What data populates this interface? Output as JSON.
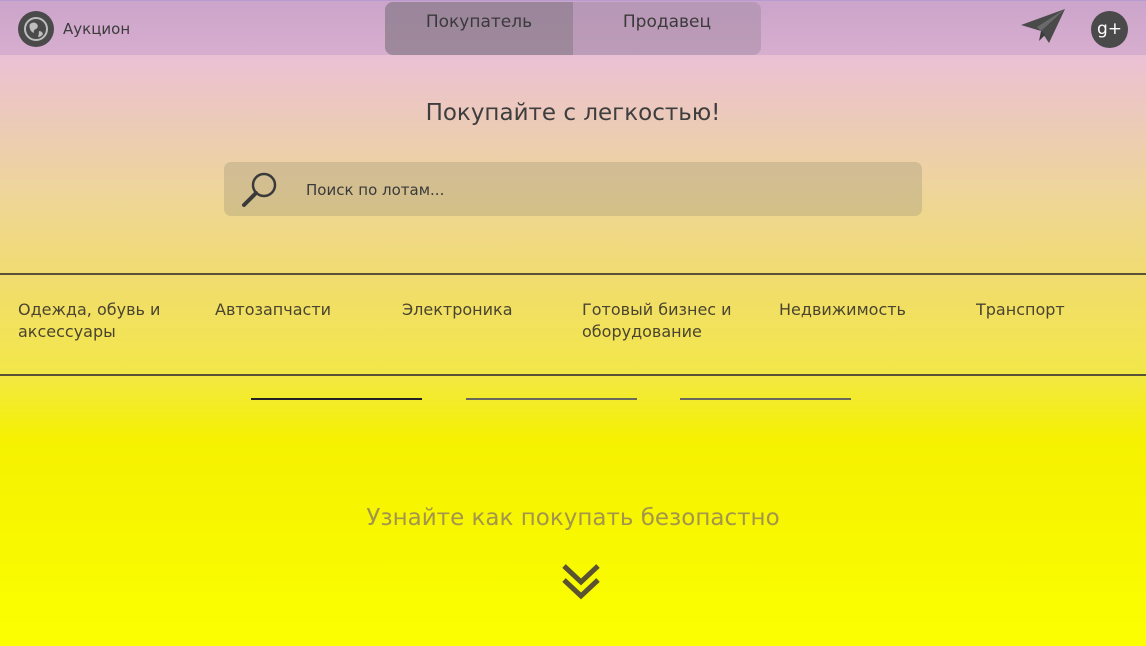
{
  "header": {
    "logo_text": "Аукцион",
    "tabs": [
      {
        "label": "Покупатель",
        "active": true
      },
      {
        "label": "Продавец",
        "active": false
      }
    ],
    "icons": [
      "globe-icon",
      "send-icon",
      "google-plus-icon"
    ],
    "gplus_text": "g+"
  },
  "hero": {
    "title": "Покупайте с легкостью!",
    "search_placeholder": "Поиск по лотам..."
  },
  "categories": [
    "Одежда, обувь и аксессуары",
    "Автозапчасти",
    "Электроника",
    "Готовый бизнес и оборудование",
    "Недвижимость",
    "Транспорт"
  ],
  "slider": {
    "count": 3,
    "active_index": 0
  },
  "footer": {
    "learn_text": "Узнайте как покупать безопастно"
  },
  "colors": {
    "dark": "#4a4a4a",
    "text": "#3e3e3e",
    "accent_text": "#a3964a",
    "bg_bottom": "#fbff00"
  }
}
